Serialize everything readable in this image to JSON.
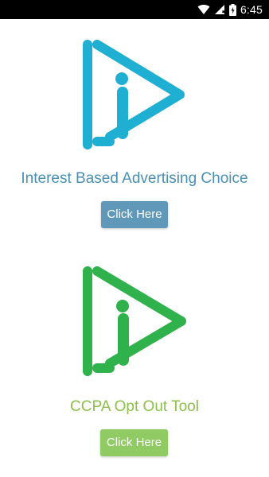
{
  "status_bar": {
    "time": "6:45",
    "icons": [
      "wifi-icon",
      "signal-icon",
      "battery-charging-icon"
    ]
  },
  "sections": [
    {
      "logo": "play-info-logo",
      "title": "Interest Based Advertising Choice",
      "button_label": "Click Here"
    },
    {
      "logo": "play-info-logo",
      "title": "CCPA Opt Out Tool",
      "button_label": "Click Here"
    }
  ],
  "colors": {
    "blue_accent": "#1eafd3",
    "blue_text": "#4a8fb4",
    "blue_button": "#5f98b8",
    "green_accent": "#2fb24b",
    "green_text": "#8cc04a",
    "green_button": "#8fca62",
    "status_bar_bg": "#000000",
    "page_bg": "#ffffff"
  }
}
